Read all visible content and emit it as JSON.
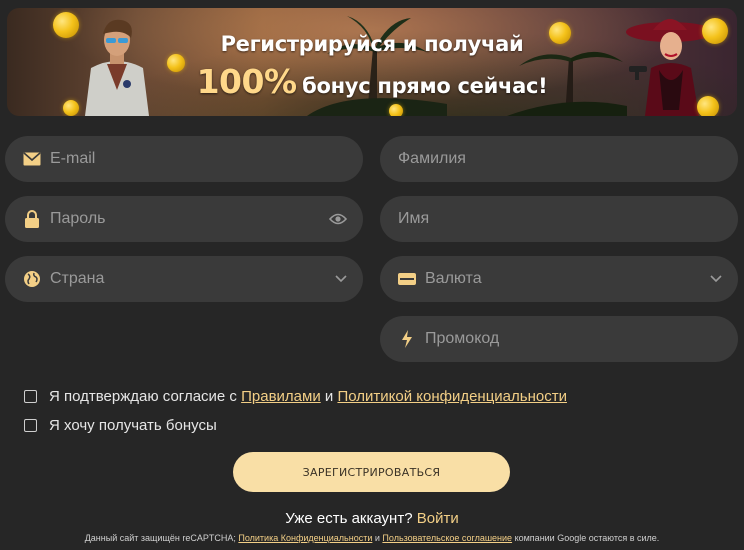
{
  "banner": {
    "title": "Регистрируйся и получай",
    "percent": "100%",
    "subtitle": "бонус прямо сейчас!"
  },
  "form": {
    "email_placeholder": "E-mail",
    "lastname_placeholder": "Фамилия",
    "password_placeholder": "Пароль",
    "name_placeholder": "Имя",
    "country_label": "Страна",
    "currency_label": "Валюта",
    "promo_placeholder": "Промокод"
  },
  "consent": {
    "prefix": "Я подтверждаю согласие с",
    "rules_link": "Правилами",
    "and": "и",
    "privacy_link": "Политикой конфиденциальности"
  },
  "bonus_label": "Я хочу получать бонусы",
  "register_button": "ЗАРЕГИСТРИРОВАТЬСЯ",
  "login": {
    "question": "Уже есть аккаунт?",
    "link": "Войти"
  },
  "recaptcha": {
    "prefix": "Данный сайт защищён reCAPTCHA;",
    "privacy_link": "Политика Конфиденциальности",
    "and": "и",
    "terms_link": "Пользовательское соглашение",
    "suffix": "компании Google остаются в силе."
  },
  "colors": {
    "background": "#262626",
    "field": "#3a3a3a",
    "accent": "#f3cf86",
    "button": "#f9dfa6"
  },
  "icons": {
    "email": "envelope-icon",
    "password": "lock-icon",
    "show_password": "eye-icon",
    "country": "globe-icon",
    "currency": "money-icon",
    "promo": "lightning-icon",
    "dropdown": "chevron-down-icon"
  }
}
